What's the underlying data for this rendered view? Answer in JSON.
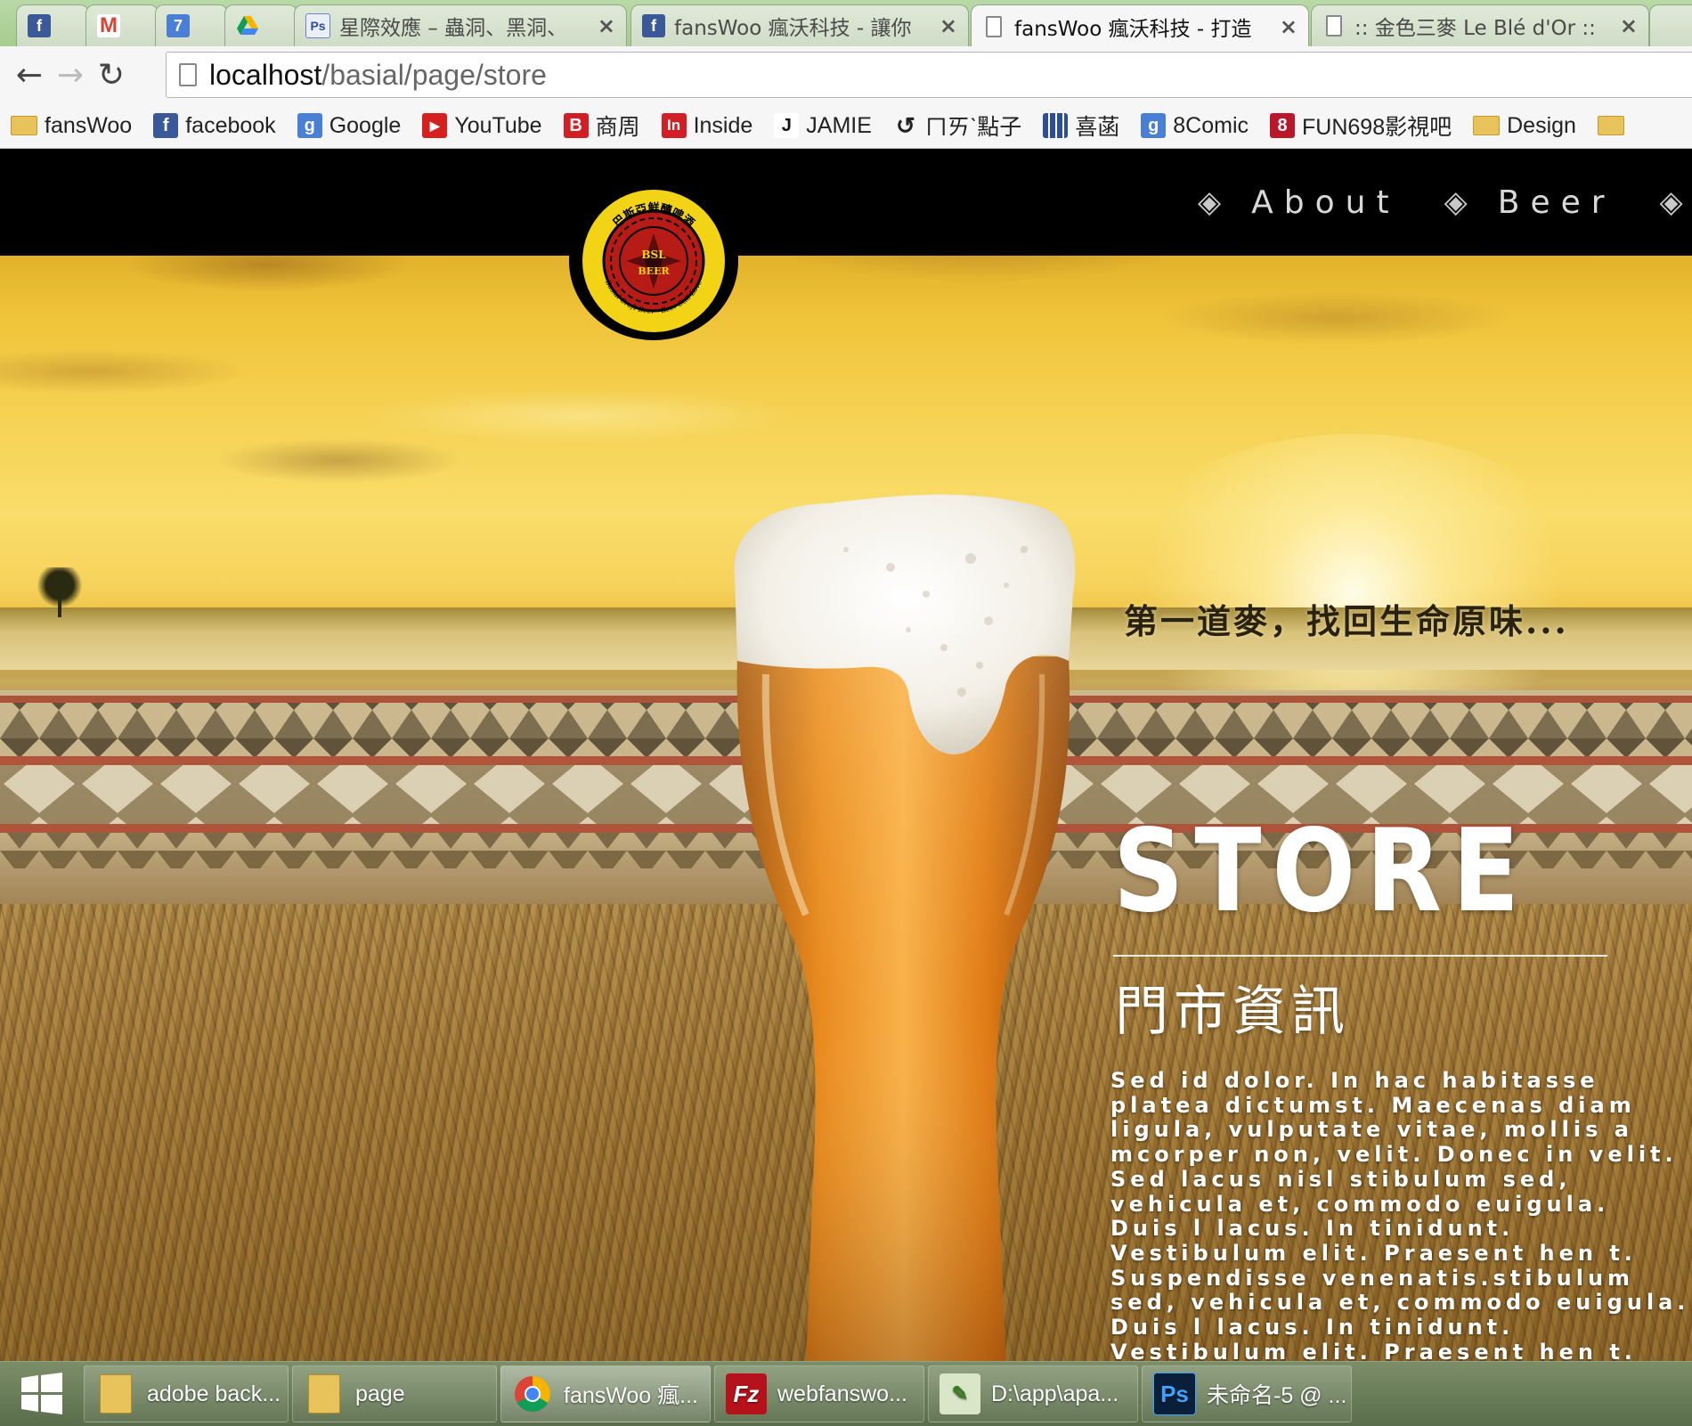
{
  "browser": {
    "tabs": [
      {
        "title": "",
        "favicon": "facebook-icon",
        "active": false,
        "closable": false
      },
      {
        "title": "",
        "favicon": "gmail-icon",
        "active": false,
        "closable": false
      },
      {
        "title": "",
        "favicon": "calendar-icon",
        "calendar_day": "7",
        "active": false,
        "closable": false
      },
      {
        "title": "",
        "favicon": "google-drive-icon",
        "active": false,
        "closable": false
      },
      {
        "title": "星際效應 – 蟲洞、黑洞、",
        "favicon": "photoshop-page-icon",
        "active": false,
        "closable": true
      },
      {
        "title": "fansWoo 瘋沃科技 - 讓你",
        "favicon": "facebook-icon",
        "active": false,
        "closable": true
      },
      {
        "title": "fansWoo 瘋沃科技 - 打造",
        "favicon": "page-icon",
        "active": true,
        "closable": true
      },
      {
        "title": ":: 金色三麥 Le Blé d'Or ::",
        "favicon": "page-icon",
        "active": false,
        "closable": true
      }
    ],
    "close_glyph": "×",
    "nav": {
      "back": "←",
      "forward": "→",
      "reload": "↻"
    },
    "url": {
      "host": "localhost",
      "path": "/basial/page/store"
    },
    "bookmarks": [
      {
        "label": "fansWoo",
        "icon": "folder-icon"
      },
      {
        "label": "facebook",
        "icon": "facebook-icon"
      },
      {
        "label": "Google",
        "icon": "google-icon"
      },
      {
        "label": "YouTube",
        "icon": "youtube-icon"
      },
      {
        "label": "商周",
        "icon": "businessweekly-icon"
      },
      {
        "label": "Inside",
        "icon": "inside-icon"
      },
      {
        "label": "JAMIE",
        "icon": "jamie-icon"
      },
      {
        "label": "ㄇㄞˋ點子",
        "icon": "swirl-icon"
      },
      {
        "label": "喜菡",
        "icon": "grid-icon"
      },
      {
        "label": "8Comic",
        "icon": "google-icon"
      },
      {
        "label": "FUN698影視吧",
        "icon": "fun698-icon"
      },
      {
        "label": "Design",
        "icon": "folder-icon"
      },
      {
        "label": "",
        "icon": "folder-icon"
      }
    ]
  },
  "site": {
    "nav": [
      {
        "label": "About"
      },
      {
        "label": "Beer"
      }
    ],
    "nav_separator": "◈",
    "logo": {
      "ring_text": "巴斯亞鮮釀啤酒",
      "ring_text_en": "Basial Craft Beer · Beer Still Love",
      "center_text_1": "BSL",
      "center_text_2": "BEER"
    },
    "slogan": "第一道麥，找回生命原味...",
    "store": {
      "title": "STORE",
      "subtitle": "門市資訊",
      "body": "Sed id dolor. In hac habitasse platea dictumst. Maecenas diam ligula, vulputate vitae, mollis a mcorper non, velit. Donec in velit. Sed lacus nisl stibulum sed, vehicula et, commodo euigula. Duis l lacus. In tinidunt. Vestibulum elit. Praesent hen t. Suspendisse venenatis.stibulum sed, vehicula et, commodo euigula. Duis l lacus. In tinidunt. Vestibulum elit. Praesent hen t. Suspendisse venenatis."
    }
  },
  "taskbar": {
    "items": [
      {
        "label": "adobe back...",
        "icon": "folder-icon",
        "active": false
      },
      {
        "label": "page",
        "icon": "folder-icon",
        "active": false
      },
      {
        "label": "fansWoo 瘋...",
        "icon": "chrome-icon",
        "active": true
      },
      {
        "label": "webfanswo...",
        "icon": "filezilla-icon",
        "active": false
      },
      {
        "label": "D:\\app\\apa...",
        "icon": "notepad-icon",
        "active": false
      },
      {
        "label": "未命名-5 @ ...",
        "icon": "photoshop-icon",
        "active": false
      }
    ]
  },
  "colors": {
    "header_bg": "#000000",
    "title_text": "#ffffff",
    "slogan_text": "#2a2210",
    "tab_strip": "#b9d9a6"
  }
}
